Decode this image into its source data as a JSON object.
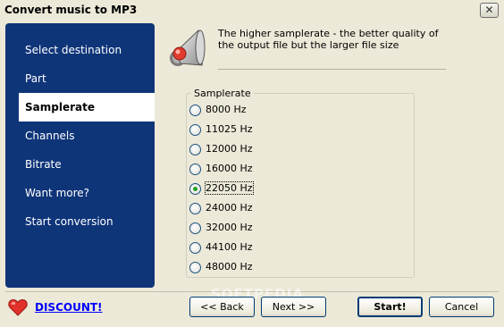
{
  "window": {
    "title": "Convert music to MP3",
    "close_glyph": "✕"
  },
  "sidebar": {
    "items": [
      {
        "label": "Select destination"
      },
      {
        "label": "Part"
      },
      {
        "label": "Samplerate",
        "active": true
      },
      {
        "label": "Channels"
      },
      {
        "label": "Bitrate"
      },
      {
        "label": "Want more?"
      },
      {
        "label": "Start conversion"
      }
    ]
  },
  "main": {
    "icon": "speaker-icon",
    "description": "The higher samplerate  - the better quality of the output file but the larger file size",
    "group_title": "Samplerate",
    "options": [
      {
        "label": "8000 Hz",
        "selected": false
      },
      {
        "label": "11025 Hz",
        "selected": false
      },
      {
        "label": "12000 Hz",
        "selected": false
      },
      {
        "label": "16000 Hz",
        "selected": false
      },
      {
        "label": "22050 Hz",
        "selected": true
      },
      {
        "label": "24000 Hz",
        "selected": false
      },
      {
        "label": "32000 Hz",
        "selected": false
      },
      {
        "label": "44100 Hz",
        "selected": false
      },
      {
        "label": "48000 Hz",
        "selected": false
      }
    ]
  },
  "footer": {
    "discount_label": "DISCOUNT!",
    "back_label": "<< Back",
    "next_label": "Next >>",
    "start_label": "Start!",
    "cancel_label": "Cancel",
    "watermark": "SOFTPEDIA"
  },
  "colors": {
    "sidebar_bg": "#0f3579",
    "radio_selected": "#21a121",
    "link": "#0000ff",
    "heart": "#e0322a"
  }
}
